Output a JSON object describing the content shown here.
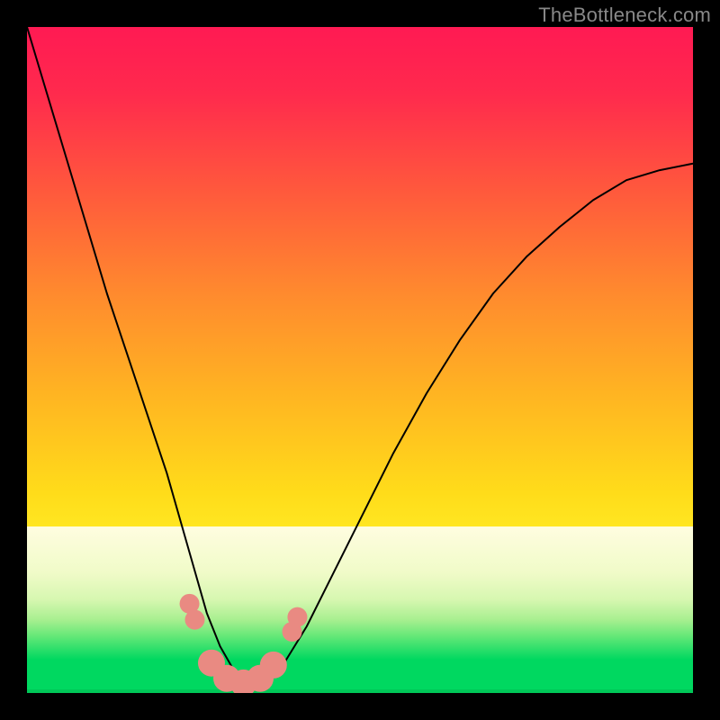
{
  "watermark": "TheBottleneck.com",
  "chart_data": {
    "type": "line",
    "title": "",
    "xlabel": "",
    "ylabel": "",
    "xlim": [
      0,
      100
    ],
    "ylim": [
      0,
      100
    ],
    "grid": false,
    "background_gradient_top": "#ff1a4d",
    "background_gradient_bottom": "#00e060",
    "series": [
      {
        "name": "curve",
        "stroke": "#000000",
        "stroke_width": 2,
        "x": [
          0,
          3,
          6,
          9,
          12,
          15,
          18,
          21,
          23,
          25,
          27,
          29,
          31,
          33,
          35,
          38,
          42,
          46,
          50,
          55,
          60,
          65,
          70,
          75,
          80,
          85,
          90,
          95,
          100
        ],
        "y": [
          100,
          90,
          80,
          70,
          60,
          51,
          42,
          33,
          26,
          19,
          12,
          7,
          3.5,
          1.2,
          1.2,
          3.5,
          10,
          18,
          26,
          36,
          45,
          53,
          60,
          65.5,
          70,
          74,
          77,
          78.5,
          79.5
        ]
      }
    ],
    "markers": {
      "name": "highlight-dots",
      "fill": "#e98a82",
      "r_small": 11,
      "r_big": 15,
      "points": [
        {
          "x": 24.4,
          "y": 13.4,
          "r": 11
        },
        {
          "x": 25.2,
          "y": 11.0,
          "r": 11
        },
        {
          "x": 27.7,
          "y": 4.5,
          "r": 15
        },
        {
          "x": 30.0,
          "y": 2.2,
          "r": 15
        },
        {
          "x": 32.5,
          "y": 1.5,
          "r": 15
        },
        {
          "x": 35.0,
          "y": 2.2,
          "r": 15
        },
        {
          "x": 37.0,
          "y": 4.2,
          "r": 15
        },
        {
          "x": 39.8,
          "y": 9.2,
          "r": 11
        },
        {
          "x": 40.6,
          "y": 11.4,
          "r": 11
        }
      ]
    },
    "green_band": {
      "y0": 0,
      "y1": 5
    },
    "pale_band": {
      "y0": 5,
      "y1": 25
    }
  }
}
